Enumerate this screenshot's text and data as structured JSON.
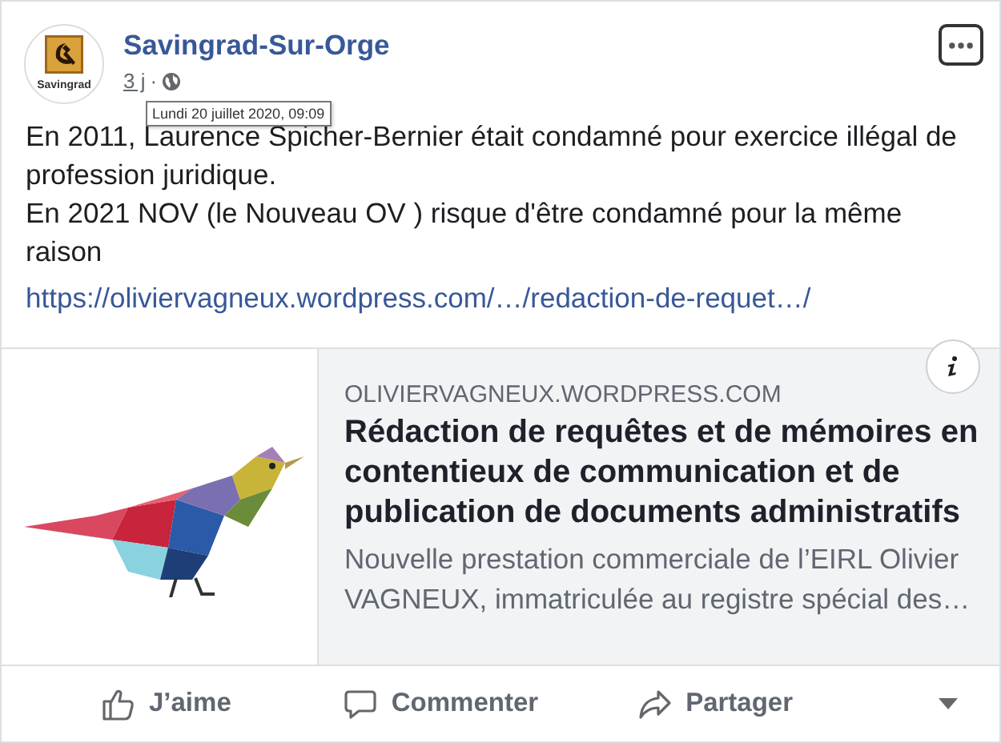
{
  "page": {
    "name": "Savingrad-Sur-Orge",
    "avatar_label": "Savingrad"
  },
  "timestamp": {
    "age": "3 j",
    "separator": "·",
    "tooltip": "Lundi 20 juillet 2020, 09:09"
  },
  "post_text": [
    "En 2011, Laurence Spicher-Bernier était condamné pour exercice illégal de profession juridique.",
    "En 2021 NOV (le Nouveau OV ) risque d'être condamné pour la même raison"
  ],
  "link": "https://oliviervagneux.wordpress.com/…/redaction-de-requet…/",
  "preview": {
    "domain": "OLIVIERVAGNEUX.WORDPRESS.COM",
    "title": "Rédaction de requêtes et de mémoires en contentieux de communication et de publication de documents administratifs",
    "description": "Nouvelle prestation commerciale de l’EIRL Olivier VAGNEUX, immatriculée au registre spécial des…"
  },
  "actions": [
    {
      "kind": "like",
      "label": "J’aime"
    },
    {
      "kind": "comment",
      "label": "Commenter"
    },
    {
      "kind": "share",
      "label": "Partager"
    }
  ]
}
